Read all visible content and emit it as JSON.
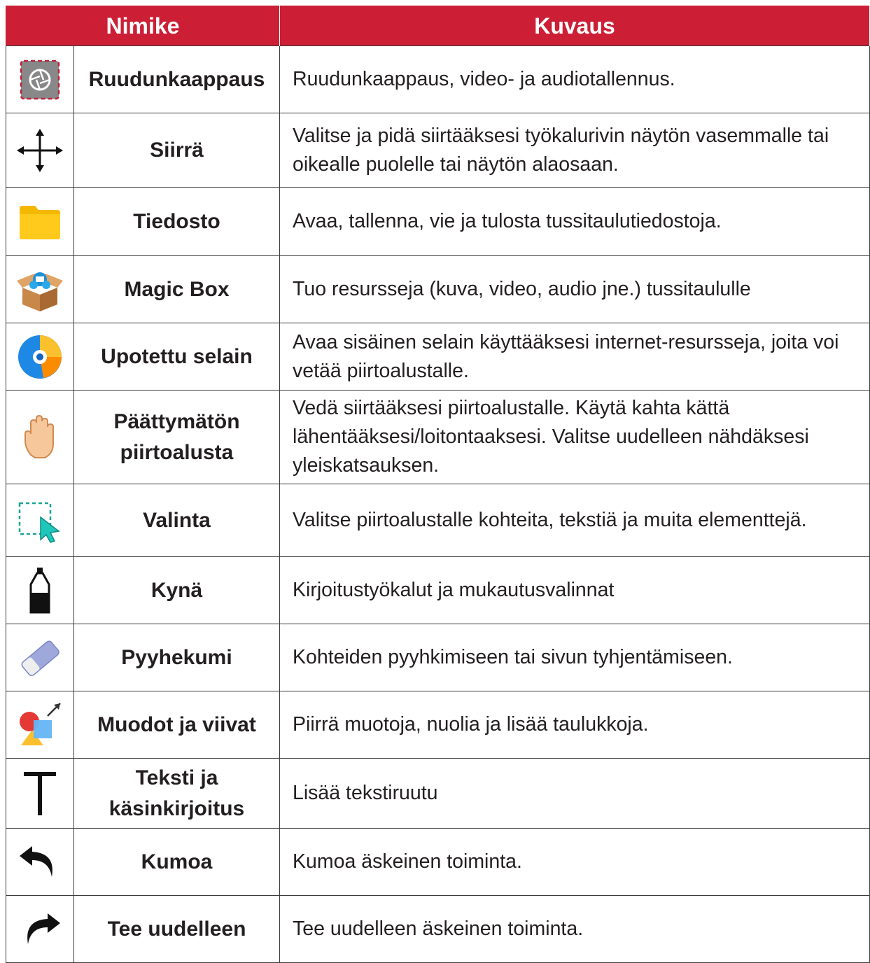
{
  "table": {
    "headers": {
      "name": "Nimike",
      "description": "Kuvaus"
    },
    "rows": [
      {
        "icon": "screenshot-icon",
        "name": "Ruudunkaappaus",
        "description": "Ruudunkaappaus, video- ja audiotallennus."
      },
      {
        "icon": "move-icon",
        "name": "Siirrä",
        "description": "Valitse ja pidä siirtääksesi työkalurivin näytön vasemmalle tai oikealle puolelle tai näytön alaosaan."
      },
      {
        "icon": "folder-icon",
        "name": "Tiedosto",
        "description": "Avaa, tallenna, vie ja tulosta tussitaulutiedostoja."
      },
      {
        "icon": "magic-box-icon",
        "name": "Magic Box",
        "description": "Tuo resursseja (kuva, video, audio jne.) tussitaululle"
      },
      {
        "icon": "browser-icon",
        "name": "Upotettu selain",
        "description": "Avaa sisäinen selain käyttääksesi internet-resursseja, joita voi vetää piirtoalustalle."
      },
      {
        "icon": "hand-icon",
        "name": "Päättymätön piirtoalusta",
        "description": "Vedä siirtääksesi piirtoalustalle. Käytä kahta kättä lähentääksesi/loitontaaksesi. Valitse uudelleen nähdäksesi yleiskatsauksen."
      },
      {
        "icon": "selection-icon",
        "name": "Valinta",
        "description": "Valitse piirtoalustalle kohteita, tekstiä ja muita elementtejä."
      },
      {
        "icon": "pen-icon",
        "name": "Kynä",
        "description": "Kirjoitustyökalut ja mukautusvalinnat"
      },
      {
        "icon": "eraser-icon",
        "name": "Pyyhekumi",
        "description": "Kohteiden pyyhkimiseen tai sivun tyhjentämiseen."
      },
      {
        "icon": "shapes-icon",
        "name": "Muodot ja viivat",
        "description": "Piirrä muotoja, nuolia ja lisää taulukkoja."
      },
      {
        "icon": "text-icon",
        "name": "Teksti ja käsinkirjoitus",
        "description": "Lisää tekstiruutu"
      },
      {
        "icon": "undo-icon",
        "name": "Kumoa",
        "description": "Kumoa äskeinen toiminta."
      },
      {
        "icon": "redo-icon",
        "name": "Tee uudelleen",
        "description": "Tee uudelleen äskeinen toiminta."
      }
    ]
  }
}
